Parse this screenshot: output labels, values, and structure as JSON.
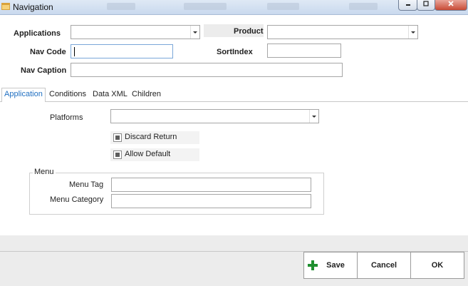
{
  "window": {
    "title": "Navigation"
  },
  "fields": {
    "applications_label": "Applications",
    "product_label": "Product",
    "nav_code_label": "Nav Code",
    "sort_index_label": "SortIndex",
    "nav_caption_label": "Nav Caption",
    "applications_value": "",
    "product_value": "",
    "nav_code_value": "",
    "sort_index_value": "",
    "nav_caption_value": ""
  },
  "tabs": [
    {
      "label": "Application",
      "active": true
    },
    {
      "label": "Conditions",
      "active": false
    },
    {
      "label": "Data XML",
      "active": false
    },
    {
      "label": "Children",
      "active": false
    }
  ],
  "application": {
    "platforms_label": "Platforms",
    "platforms_value": "",
    "discard_return_label": "Discard Return",
    "discard_return_state": "indeterminate",
    "allow_default_label": "Allow Default",
    "allow_default_state": "indeterminate",
    "menu_group_label": "Menu",
    "menu_tag_label": "Menu Tag",
    "menu_tag_value": "",
    "menu_category_label": "Menu Category",
    "menu_category_value": ""
  },
  "buttons": {
    "save": "Save",
    "cancel": "Cancel",
    "ok": "OK"
  },
  "icons": {
    "window": "navigation-app-icon",
    "save": "plus-icon"
  },
  "colors": {
    "active_tab": "#1f6fc1",
    "save_plus": "#1f8f2f",
    "close_button": "#c84a35"
  }
}
